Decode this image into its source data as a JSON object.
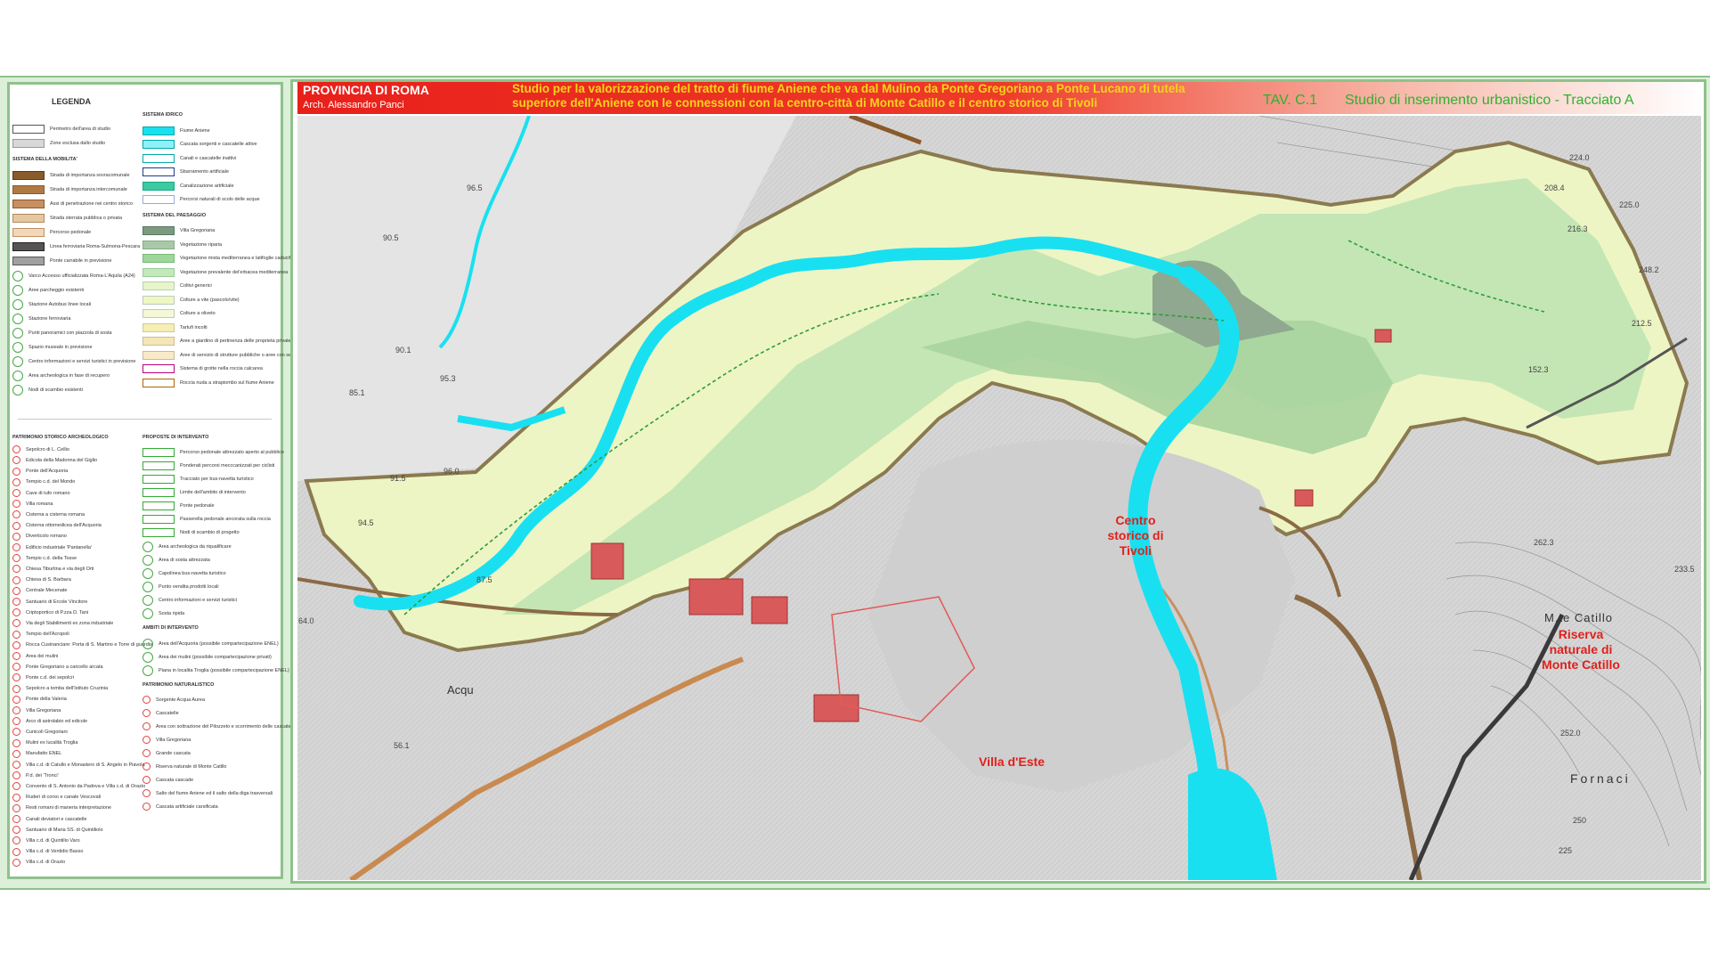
{
  "header": {
    "province": "PROVINCIA DI ROMA",
    "architect": "Arch. Alessandro Panci",
    "study_line1": "Studio per la valorizzazione del tratto di fiume Aniene che va dal Mulino da Ponte Gregoriano a Ponte Lucano di tutela",
    "study_line2": "superiore dell'Aniene con le connessioni con la centro-città di Monte Catillo e il centro storico di Tivoli",
    "tav": "TAV. C.1",
    "subtitle": "Studio di inserimento urbanistico - Tracciato A"
  },
  "places": {
    "centro_storico": "Centro storico di Tivoli",
    "villa_este": "Villa d'Este",
    "riserva": "Riserva naturale di Monte Catillo",
    "mte_catillo": "M.te Catillo",
    "fornaci": "Fornaci",
    "acqu": "Acqu"
  },
  "elevations": [
    "224.0",
    "208.4",
    "225.0",
    "216.3",
    "248.2",
    "212.5",
    "152.3",
    "96.5",
    "90.5",
    "90.1",
    "95.3",
    "85.1",
    "91.5",
    "96.0",
    "94.5",
    "87.5",
    "56.1",
    "64.0",
    "262.3",
    "233.5",
    "252.0",
    "250",
    "225"
  ],
  "legend": {
    "title": "LEGENDA",
    "col1": [
      {
        "label": "Perimetro dell'area di studio",
        "swatch": "#ffffff",
        "border": "#555"
      },
      {
        "label": "Zone esclusa dallo studio",
        "swatch": "#d8d8d8",
        "border": "#999"
      },
      {
        "section": "SISTEMA DELLA MOBILITA'"
      },
      {
        "label": "Strada di importanza sovracomunale",
        "swatch": "#8b5a2b",
        "border": "#5a3a1a"
      },
      {
        "label": "Strada di importanza intercomunale",
        "swatch": "#b07a45",
        "border": "#8b5a2b"
      },
      {
        "label": "Assi di penetrazione nei centro storico",
        "swatch": "#c89060",
        "border": "#8b5a2b"
      },
      {
        "label": "Strada sterrata pubblica o privata",
        "swatch": "#e6c7a0",
        "border": "#b08a60"
      },
      {
        "label": "Percorso pedonale",
        "swatch": "#f0d8b8",
        "border": "#c09060"
      },
      {
        "label": "Linea ferroviaria Roma-Sulmona-Pescara",
        "swatch": "#555555",
        "border": "#222"
      },
      {
        "label": "Ponte carrabile in previsione",
        "swatch": "#a0a0a0",
        "border": "#555"
      },
      {
        "label": "Varco Accesso ufficializzata Roma-L'Aquila (A24)",
        "symbol": "ring"
      },
      {
        "label": "Aree parcheggio esistenti",
        "symbol": "ring"
      },
      {
        "label": "Stazione Autobus linee locali",
        "symbol": "ring"
      },
      {
        "label": "Stazione ferroviaria",
        "symbol": "ring"
      },
      {
        "label": "Punti panoramici con piazzola di sosta",
        "symbol": "ring"
      },
      {
        "label": "Spazio museale in previsione",
        "symbol": "ring"
      },
      {
        "label": "Centro informazioni e servizi turistici in previsione",
        "symbol": "ring"
      },
      {
        "label": "Area archeologica in fase di recupero",
        "symbol": "ring"
      },
      {
        "label": "Nodi di scambio esistenti",
        "symbol": "ring"
      }
    ],
    "col2": [
      {
        "section": "SISTEMA IDRICO"
      },
      {
        "label": "Fiume Aniene",
        "swatch": "#19e0f0",
        "border": "#0aa"
      },
      {
        "label": "Cascata sorgenti e cascatelle attive",
        "swatch": "#8ff0f8",
        "border": "#0aa"
      },
      {
        "label": "Canali e cascatelle inattivi",
        "swatch": "#ffffff",
        "border": "#0aa"
      },
      {
        "label": "Sbarramento artificiale",
        "swatch": "#ffffff",
        "border": "#223a88"
      },
      {
        "label": "Canalizzazione artificiale",
        "swatch": "#3fc9a0",
        "border": "#1a8"
      },
      {
        "label": "Percorsi naturali di scolo delle acque",
        "swatch": "#ffffff",
        "border": "#9ad"
      },
      {
        "section": "SISTEMA DEL PAESAGGIO"
      },
      {
        "label": "Villa Gregoriana",
        "swatch": "#7e9a7e",
        "border": "#576"
      },
      {
        "label": "Vegetazione riparia",
        "swatch": "#a8c8a8",
        "border": "#8a8"
      },
      {
        "label": "Vegetazione mista mediterranea e latifoglie caducifoglie",
        "swatch": "#9ed79a",
        "border": "#7b7"
      },
      {
        "label": "Vegetazione prevalente del'erbacea mediterranea",
        "swatch": "#c3e8b9",
        "border": "#9c9"
      },
      {
        "label": "Coltivi generici",
        "swatch": "#e8f5c8",
        "border": "#bcb"
      },
      {
        "label": "Colture a vite (pascolo/vite)",
        "swatch": "#eef7c2",
        "border": "#bcb"
      },
      {
        "label": "Colture a oliveto",
        "swatch": "#f4f8d6",
        "border": "#bcb"
      },
      {
        "label": "Tartufi incolti",
        "swatch": "#f6eeb2",
        "border": "#cc9"
      },
      {
        "label": "Aree a giardino di pertinenza delle proprieta private",
        "swatch": "#f5e6b8",
        "border": "#cb9"
      },
      {
        "label": "Aree di servizio di strutture pubbliche o aree con servizi pubblici",
        "swatch": "#f8eac8",
        "border": "#cb9"
      },
      {
        "label": "Sistema di grotte nella roccia calcarea",
        "swatch": "#ffffff",
        "border": "#b07"
      },
      {
        "label": "Roccia nuda a strapiombo sul fiume Aniene",
        "swatch": "#ffffff",
        "border": "#a60"
      }
    ],
    "col3": [
      {
        "section": "PATRIMONIO STORICO ARCHEOLOGICO"
      },
      {
        "label": "Sepolcro di L. Cellio"
      },
      {
        "label": "Edicola della Madonna del Giglio"
      },
      {
        "label": "Ponte dell'Acquoria"
      },
      {
        "label": "Tempio c.d. del Mondo"
      },
      {
        "label": "Cave di tufo romano"
      },
      {
        "label": "Villa romana"
      },
      {
        "label": "Cisterna a cisterna romana"
      },
      {
        "label": "Cisterna ottomedicea dell'Acquoria"
      },
      {
        "label": "Diverticolo romano"
      },
      {
        "label": "Edificio industriale 'Pantanella'"
      },
      {
        "label": "Tempio c.d. della Tosse"
      },
      {
        "label": "Chiesa Tiburtina e via degli Orti"
      },
      {
        "label": "Chiesa di S. Barbara"
      },
      {
        "label": "Centrale Mecenate"
      },
      {
        "label": "Santuario di Ercole Vincitore"
      },
      {
        "label": "Criptoportico di P.zza D. Tani"
      },
      {
        "label": "Via degli Stabilimenti ex zona industriale"
      },
      {
        "label": "Tempio dell'Acropoli"
      },
      {
        "label": "Rocca Cusinanciare: Porta di S. Martino e Torre di guardia"
      },
      {
        "label": "Area dei mulini"
      },
      {
        "label": "Ponte Gregoriano a cancello arcata"
      },
      {
        "label": "Ponte c.d. dei sepolcri"
      },
      {
        "label": "Sepolcro a tomba dell'Istituto Cruzinia"
      },
      {
        "label": "Ponte della Valeria"
      },
      {
        "label": "Villa Gregoriana"
      },
      {
        "label": "Arco di astrolabio ed edicole"
      },
      {
        "label": "Cunicoli Gregoriani"
      },
      {
        "label": "Mulini ex lucalità Troglia"
      },
      {
        "label": "Manufatto ENEL"
      },
      {
        "label": "Villa c.d. di Catullo e Monastero di S. Angelo in Piavola"
      },
      {
        "label": "P.d. dei 'Tronci'"
      },
      {
        "label": "Convento di S. Antonio da Padova e Villa c.d. di Orazio"
      },
      {
        "label": "Ruderi di corso e canale Vescovali"
      },
      {
        "label": "Resti romani di maneria interpretazione"
      },
      {
        "label": "Canali deviatori e cascatelle"
      },
      {
        "label": "Santuario di Maria SS. di Quintiliolo"
      },
      {
        "label": "Villa c.d. di Quintilio Varo"
      },
      {
        "label": "Villa c.d. di Ventidio Basso"
      },
      {
        "label": "Villa c.d. di Orazio"
      }
    ],
    "col4": [
      {
        "section": "PROPOSTE DI INTERVENTO"
      },
      {
        "label": "Percorso pedonale attrezzato aperto al pubblico",
        "swatch": "#ffffff",
        "border": "#3a3"
      },
      {
        "label": "Ponderati percorsi mecccanizzati per ciclisti",
        "swatch": "#ffffff",
        "border": "#3a3"
      },
      {
        "label": "Tracciato per bus-navetta turistico",
        "swatch": "#ffffff",
        "border": "#3a3"
      },
      {
        "label": "Limite dell'ambito di intervento",
        "swatch": "#ffffff",
        "border": "#3a3"
      },
      {
        "label": "Ponte pedonale",
        "swatch": "#ffffff",
        "border": "#3a3"
      },
      {
        "label": "Passerella pedonale ancorata sulla roccia",
        "swatch": "#ffffff",
        "border": "#3a3"
      },
      {
        "label": "Nodi di scambio di progetto",
        "swatch": "#ffffff",
        "border": "#3a3"
      },
      {
        "label": "Area archeologica da riqualificare",
        "symbol": "ring"
      },
      {
        "label": "Area di sosta attrezzata",
        "symbol": "ring"
      },
      {
        "label": "Capolinea bus-navetta turistico",
        "symbol": "ring"
      },
      {
        "label": "Punto vendita prodotti locali",
        "symbol": "ring"
      },
      {
        "label": "Centro informazioni e servizi turistici",
        "symbol": "ring"
      },
      {
        "label": "Sosta ripida",
        "symbol": "ring"
      },
      {
        "section": "AMBITI DI INTERVENTO"
      },
      {
        "label": "Area dell'Acquoria (possibile compartecipazione ENEL)",
        "symbol": "ring"
      },
      {
        "label": "Area dei mulini (possibile compartecipazione privati)",
        "symbol": "ring"
      },
      {
        "label": "Piana in localita Troglia (possibile compartecipazione ENEL)",
        "symbol": "ring"
      },
      {
        "section": "PATRIMONIO NATURALISTICO"
      },
      {
        "label": "Sorgente Acqua Aurea"
      },
      {
        "label": "Cascatelle"
      },
      {
        "label": "Area con sottrazione del Pilozzeto e scorrimento delle cascate"
      },
      {
        "label": "Villa Gregoriana"
      },
      {
        "label": "Grande cascata"
      },
      {
        "label": "Riserva naturale di Monte Catillo"
      },
      {
        "label": "Cascata cascade"
      },
      {
        "label": "Salto del fiume Aniene ed il salto della diga trasversali"
      },
      {
        "label": "Cascata artificiale carsificata"
      }
    ]
  },
  "colors": {
    "river": "#19e0f0",
    "accent_red": "#e0201a",
    "accent_green": "#2fb12f",
    "terrain_green": "#bfe4b3",
    "terrain_yellow": "#eef5c4",
    "frame": "#8fc18c"
  }
}
